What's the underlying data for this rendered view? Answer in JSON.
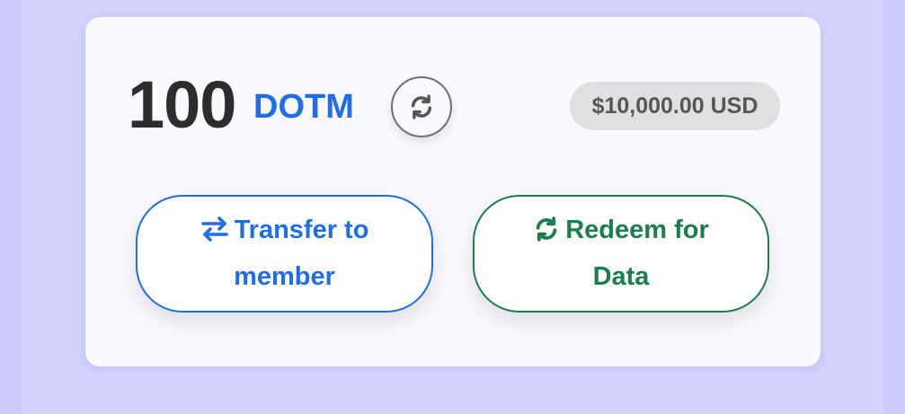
{
  "balance": {
    "amount": "100",
    "token": "DOTM",
    "usd_value": "$10,000.00 USD"
  },
  "refresh": {
    "icon": "sync-icon"
  },
  "actions": {
    "transfer_label": "Transfer to member",
    "transfer_icon": "exchange-arrows-icon",
    "redeem_label": "Redeem for Data",
    "redeem_icon": "sync-icon"
  },
  "colors": {
    "page_background": "#d3d1fd",
    "card_background": "#f8f8fd",
    "amount_text": "#2d2d2d",
    "accent_blue": "#1f6ee8",
    "accent_green": "#1a7f4b",
    "badge_background": "#e0e0e3",
    "badge_text": "#565656"
  }
}
